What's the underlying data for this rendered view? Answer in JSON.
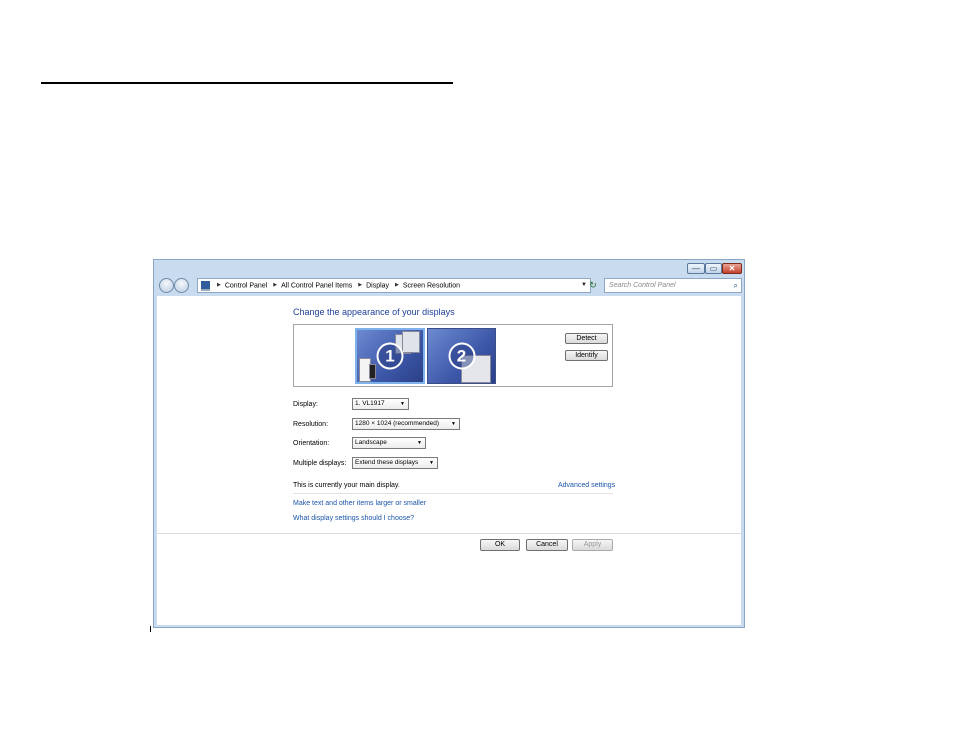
{
  "window": {
    "caption": {
      "minimize": "—",
      "maximize": "▭",
      "close": "✕"
    },
    "breadcrumbs": [
      "Control Panel",
      "All Control Panel Items",
      "Display",
      "Screen Resolution"
    ],
    "search_placeholder": "Search Control Panel"
  },
  "panel": {
    "heading": "Change the appearance of your displays",
    "monitors": [
      {
        "number": "1"
      },
      {
        "number": "2"
      }
    ],
    "detect_label": "Detect",
    "identify_label": "Identify",
    "display_label": "Display:",
    "display_value": "1. VL1917",
    "resolution_label": "Resolution:",
    "resolution_value": "1280 × 1024 (recommended)",
    "orientation_label": "Orientation:",
    "orientation_value": "Landscape",
    "multiple_label": "Multiple displays:",
    "multiple_value": "Extend these displays",
    "main_display_text": "This is currently your main display.",
    "advanced_link": "Advanced settings",
    "link_text_size": "Make text and other items larger or smaller",
    "link_which_settings": "What display settings should I choose?",
    "ok_label": "OK",
    "cancel_label": "Cancel",
    "apply_label": "Apply"
  }
}
